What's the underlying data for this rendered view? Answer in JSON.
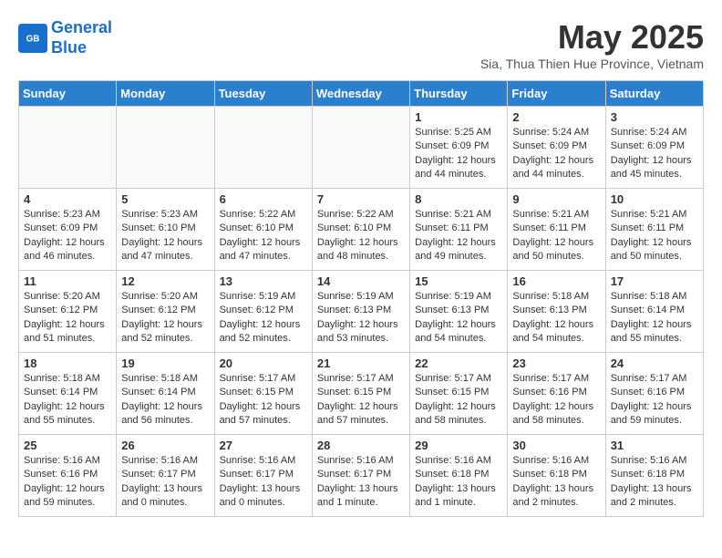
{
  "header": {
    "logo_line1": "General",
    "logo_line2": "Blue",
    "month": "May 2025",
    "location": "Sia, Thua Thien Hue Province, Vietnam"
  },
  "weekdays": [
    "Sunday",
    "Monday",
    "Tuesday",
    "Wednesday",
    "Thursday",
    "Friday",
    "Saturday"
  ],
  "weeks": [
    [
      {
        "day": "",
        "info": ""
      },
      {
        "day": "",
        "info": ""
      },
      {
        "day": "",
        "info": ""
      },
      {
        "day": "",
        "info": ""
      },
      {
        "day": "1",
        "info": "Sunrise: 5:25 AM\nSunset: 6:09 PM\nDaylight: 12 hours\nand 44 minutes."
      },
      {
        "day": "2",
        "info": "Sunrise: 5:24 AM\nSunset: 6:09 PM\nDaylight: 12 hours\nand 44 minutes."
      },
      {
        "day": "3",
        "info": "Sunrise: 5:24 AM\nSunset: 6:09 PM\nDaylight: 12 hours\nand 45 minutes."
      }
    ],
    [
      {
        "day": "4",
        "info": "Sunrise: 5:23 AM\nSunset: 6:09 PM\nDaylight: 12 hours\nand 46 minutes."
      },
      {
        "day": "5",
        "info": "Sunrise: 5:23 AM\nSunset: 6:10 PM\nDaylight: 12 hours\nand 47 minutes."
      },
      {
        "day": "6",
        "info": "Sunrise: 5:22 AM\nSunset: 6:10 PM\nDaylight: 12 hours\nand 47 minutes."
      },
      {
        "day": "7",
        "info": "Sunrise: 5:22 AM\nSunset: 6:10 PM\nDaylight: 12 hours\nand 48 minutes."
      },
      {
        "day": "8",
        "info": "Sunrise: 5:21 AM\nSunset: 6:11 PM\nDaylight: 12 hours\nand 49 minutes."
      },
      {
        "day": "9",
        "info": "Sunrise: 5:21 AM\nSunset: 6:11 PM\nDaylight: 12 hours\nand 50 minutes."
      },
      {
        "day": "10",
        "info": "Sunrise: 5:21 AM\nSunset: 6:11 PM\nDaylight: 12 hours\nand 50 minutes."
      }
    ],
    [
      {
        "day": "11",
        "info": "Sunrise: 5:20 AM\nSunset: 6:12 PM\nDaylight: 12 hours\nand 51 minutes."
      },
      {
        "day": "12",
        "info": "Sunrise: 5:20 AM\nSunset: 6:12 PM\nDaylight: 12 hours\nand 52 minutes."
      },
      {
        "day": "13",
        "info": "Sunrise: 5:19 AM\nSunset: 6:12 PM\nDaylight: 12 hours\nand 52 minutes."
      },
      {
        "day": "14",
        "info": "Sunrise: 5:19 AM\nSunset: 6:13 PM\nDaylight: 12 hours\nand 53 minutes."
      },
      {
        "day": "15",
        "info": "Sunrise: 5:19 AM\nSunset: 6:13 PM\nDaylight: 12 hours\nand 54 minutes."
      },
      {
        "day": "16",
        "info": "Sunrise: 5:18 AM\nSunset: 6:13 PM\nDaylight: 12 hours\nand 54 minutes."
      },
      {
        "day": "17",
        "info": "Sunrise: 5:18 AM\nSunset: 6:14 PM\nDaylight: 12 hours\nand 55 minutes."
      }
    ],
    [
      {
        "day": "18",
        "info": "Sunrise: 5:18 AM\nSunset: 6:14 PM\nDaylight: 12 hours\nand 55 minutes."
      },
      {
        "day": "19",
        "info": "Sunrise: 5:18 AM\nSunset: 6:14 PM\nDaylight: 12 hours\nand 56 minutes."
      },
      {
        "day": "20",
        "info": "Sunrise: 5:17 AM\nSunset: 6:15 PM\nDaylight: 12 hours\nand 57 minutes."
      },
      {
        "day": "21",
        "info": "Sunrise: 5:17 AM\nSunset: 6:15 PM\nDaylight: 12 hours\nand 57 minutes."
      },
      {
        "day": "22",
        "info": "Sunrise: 5:17 AM\nSunset: 6:15 PM\nDaylight: 12 hours\nand 58 minutes."
      },
      {
        "day": "23",
        "info": "Sunrise: 5:17 AM\nSunset: 6:16 PM\nDaylight: 12 hours\nand 58 minutes."
      },
      {
        "day": "24",
        "info": "Sunrise: 5:17 AM\nSunset: 6:16 PM\nDaylight: 12 hours\nand 59 minutes."
      }
    ],
    [
      {
        "day": "25",
        "info": "Sunrise: 5:16 AM\nSunset: 6:16 PM\nDaylight: 12 hours\nand 59 minutes."
      },
      {
        "day": "26",
        "info": "Sunrise: 5:16 AM\nSunset: 6:17 PM\nDaylight: 13 hours\nand 0 minutes."
      },
      {
        "day": "27",
        "info": "Sunrise: 5:16 AM\nSunset: 6:17 PM\nDaylight: 13 hours\nand 0 minutes."
      },
      {
        "day": "28",
        "info": "Sunrise: 5:16 AM\nSunset: 6:17 PM\nDaylight: 13 hours\nand 1 minute."
      },
      {
        "day": "29",
        "info": "Sunrise: 5:16 AM\nSunset: 6:18 PM\nDaylight: 13 hours\nand 1 minute."
      },
      {
        "day": "30",
        "info": "Sunrise: 5:16 AM\nSunset: 6:18 PM\nDaylight: 13 hours\nand 2 minutes."
      },
      {
        "day": "31",
        "info": "Sunrise: 5:16 AM\nSunset: 6:18 PM\nDaylight: 13 hours\nand 2 minutes."
      }
    ]
  ]
}
